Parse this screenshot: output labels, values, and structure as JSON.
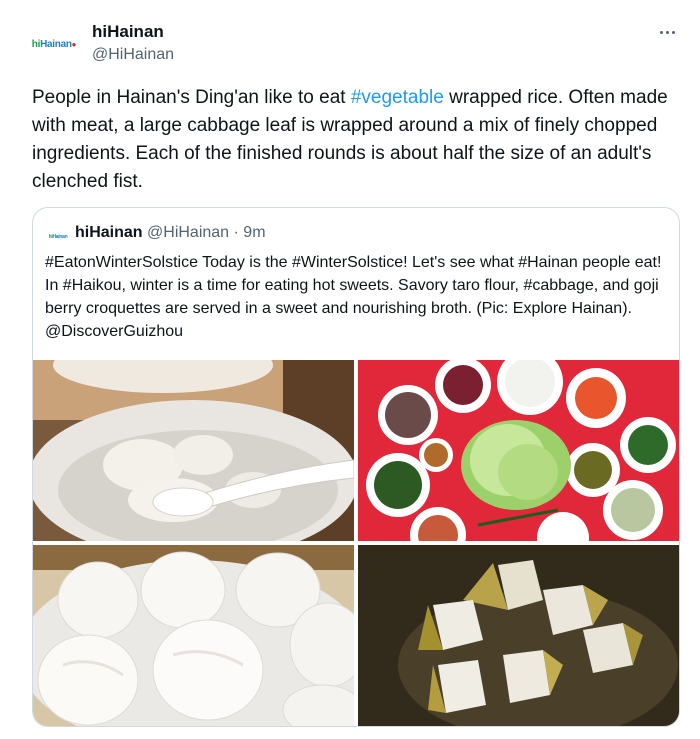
{
  "tweet": {
    "display_name": "hiHainan",
    "handle": "@HiHainan",
    "avatar_logo": {
      "part1": "hi",
      "part2": "Hainan"
    },
    "text_before": "People in Hainan's Ding'an like to eat ",
    "hashtag": "#vegetable",
    "text_after": " wrapped rice. Often made with meat, a large cabbage leaf is wrapped around a mix of finely chopped ingredients. Each of the finished rounds is about half the size of an adult's clenched fist."
  },
  "quote": {
    "display_name": "hiHainan",
    "handle": "@HiHainan",
    "separator": " · ",
    "time": "9m",
    "text": "#EatonWinterSolstice Today is the #WinterSolstice! Let's see what #Hainan people eat! In #Haikou, winter is a time for eating hot sweets. Savory taro flour, #cabbage, and goji berry croquettes are served in a sweet and nourishing broth. (Pic: Explore Hainan). @DiscoverGuizhou"
  },
  "colors": {
    "accent": "#1d9bf0",
    "secondary_text": "#536471",
    "border": "#cfd9de",
    "photo_red_background": "#e0283a"
  },
  "icons": {
    "more": "more-horizontal-icon"
  }
}
